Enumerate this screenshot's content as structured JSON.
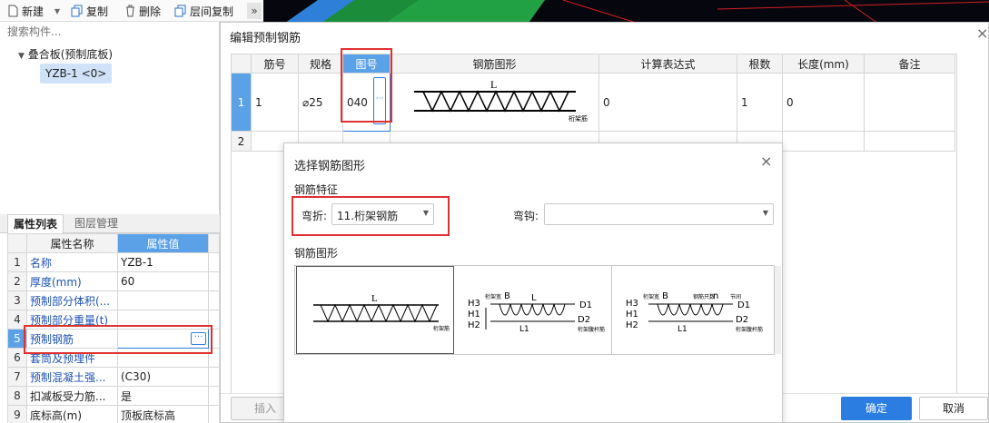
{
  "toolbar": {
    "new_label": "新建",
    "copy_label": "复制",
    "delete_label": "删除",
    "floor_copy_label": "层间复制",
    "more_label": "»"
  },
  "search": {
    "placeholder": "搜索构件..."
  },
  "tree": {
    "parent_label": "叠合板(预制底板)",
    "child_label": "YZB-1 <0>"
  },
  "left_tabs": {
    "tab1": "属性列表",
    "tab2": "图层管理"
  },
  "props": {
    "header_name": "属性名称",
    "header_value": "属性值",
    "rows": [
      {
        "num": "1",
        "name": "名称",
        "value": "YZB-1"
      },
      {
        "num": "2",
        "name": "厚度(mm)",
        "value": "60"
      },
      {
        "num": "3",
        "name": "预制部分体积(...",
        "value": ""
      },
      {
        "num": "4",
        "name": "预制部分重量(t)",
        "value": ""
      },
      {
        "num": "5",
        "name": "预制钢筋",
        "value": ""
      },
      {
        "num": "6",
        "name": "套筒及预埋件",
        "value": ""
      },
      {
        "num": "7",
        "name": "预制混凝土强...",
        "value": "(C30)"
      },
      {
        "num": "8",
        "name": "扣减板受力筋...",
        "value": "是"
      },
      {
        "num": "9",
        "name": "底标高(m)",
        "value": "顶板底标高"
      }
    ],
    "ellipsis": "···"
  },
  "edit_dialog": {
    "title": "编辑预制钢筋",
    "close": "×",
    "columns": [
      "筋号",
      "规格",
      "图号",
      "钢筋图形",
      "计算表达式",
      "根数",
      "长度(mm)",
      "备注"
    ],
    "rows": [
      {
        "num": "1",
        "bar_no": "1",
        "spec": "⌀25",
        "fig_no": "040",
        "shape_label": "L",
        "shape_sub": "桁架筋",
        "expr": "0",
        "count": "1",
        "length": "0",
        "remark": ""
      },
      {
        "num": "2"
      }
    ],
    "ellipsis": "···",
    "insert_label": "插入",
    "ok_label": "确定",
    "cancel_label": "取消"
  },
  "shape_dialog": {
    "title": "选择钢筋图形",
    "close": "×",
    "feature_label": "钢筋特征",
    "bend_label": "弯折:",
    "bend_value": "11.桁架钢筋",
    "hook_label": "弯钩:",
    "hook_value": "",
    "shape_label": "钢筋图形",
    "shapes": [
      {
        "L": "L",
        "sub": "桁架筋"
      },
      {
        "H3": "H3",
        "H1": "H1",
        "H2": "H2",
        "B": "B",
        "L": "L",
        "L1": "L1",
        "D1": "D1",
        "D2": "D2",
        "top": "桁架宽",
        "sub": "桁架腹杆筋"
      },
      {
        "H3": "H3",
        "H1": "H1",
        "H2": "H2",
        "B": "B",
        "n": "n",
        "L1": "L1",
        "D1": "D1",
        "D2": "D2",
        "top": "桁架宽",
        "top2": "钢筋只数",
        "top3": "节间",
        "sub": "桁架腹杆筋"
      }
    ]
  },
  "colors": {
    "accent": "#5aa1e8",
    "ok": "#2b7de1",
    "highlight": "#e03131"
  }
}
